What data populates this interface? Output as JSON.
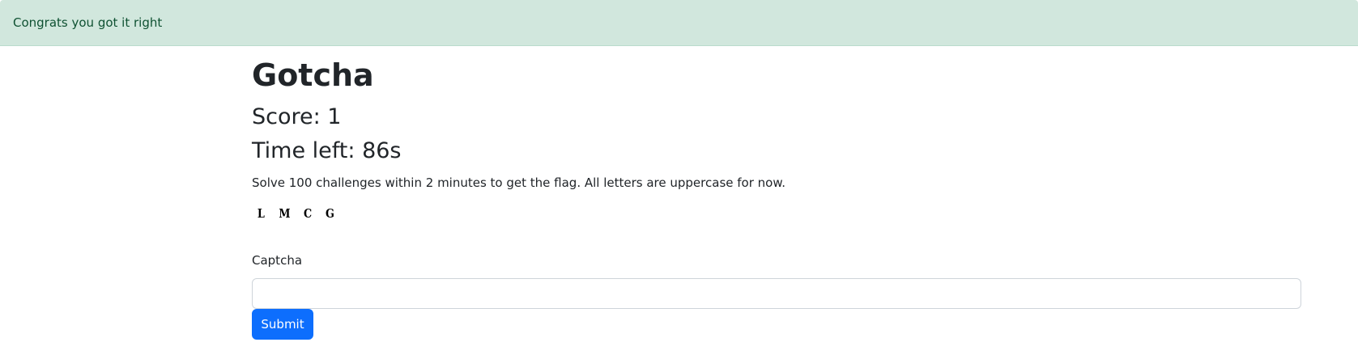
{
  "alert": {
    "message": "Congrats you got it right",
    "color": "#0f5132",
    "background": "#d1e7dd"
  },
  "page": {
    "title": "Gotcha",
    "score": "Score: 1",
    "time_left": "Time left: 86s",
    "instructions": "Solve 100 challenges within 2 minutes to get the flag. All letters are uppercase for now."
  },
  "captcha": {
    "characters": [
      "L",
      "M",
      "C",
      "G"
    ],
    "label": "Captcha",
    "input_value": "",
    "input_placeholder": ""
  },
  "form": {
    "submit_label": "Submit",
    "submit_color": "#0d6efd"
  }
}
